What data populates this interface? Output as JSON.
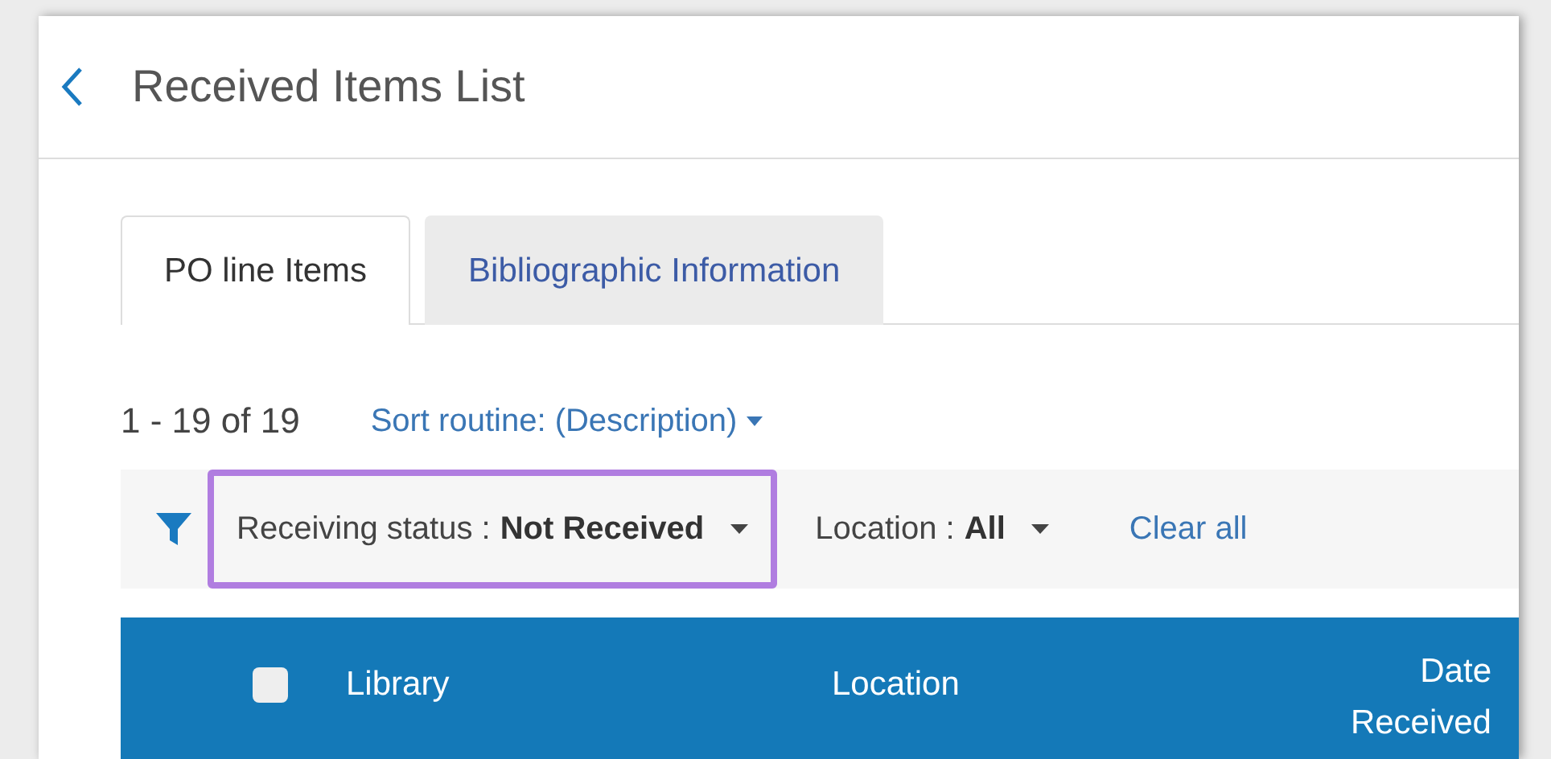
{
  "header": {
    "title": "Received Items List"
  },
  "tabs": [
    {
      "label": "PO line Items",
      "selected": true
    },
    {
      "label": "Bibliographic Information",
      "selected": false
    }
  ],
  "results": {
    "count": "1 - 19 of 19",
    "sort": "Sort routine: (Description)"
  },
  "filters": [
    {
      "label": "Receiving status :",
      "value": "Not Received",
      "highlighted": true
    },
    {
      "label": "Location :",
      "value": "All",
      "highlighted": false
    }
  ],
  "clear_all": "Clear all",
  "table": {
    "select_all_checked": false,
    "columns": [
      "Library",
      "Location",
      "Date Received"
    ]
  }
}
